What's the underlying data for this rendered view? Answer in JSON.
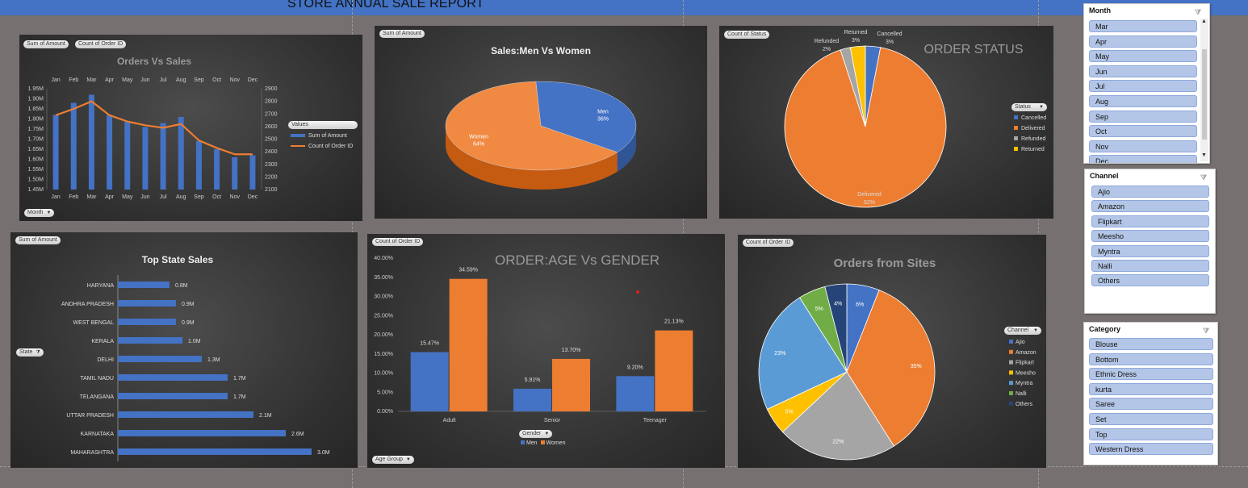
{
  "report_title": "STORE ANNUAL SALE REPORT",
  "orders_vs_sales": {
    "chips": [
      "Sum of Amount",
      "Count of Order ID"
    ],
    "axis_chip": "Month",
    "legend_chip": "Values",
    "legend": [
      "Sum of Amount",
      "Count of Order ID"
    ],
    "colors": {
      "bar": "#4472c4",
      "line": "#ed7d31"
    }
  },
  "sales_gender": {
    "chip": "Sum of Amount"
  },
  "order_status": {
    "chip": "Count of Status",
    "legend_chip": "Status"
  },
  "top_state": {
    "chip": "Sum of Amount",
    "axis_chip": "State"
  },
  "age_gender": {
    "chip": "Count of Order ID",
    "axis_chip": "Age Group",
    "legend_chip": "Gender",
    "legend": [
      "Men",
      "Women"
    ]
  },
  "sites": {
    "chip": "Count of Order ID",
    "legend_chip": "Channel"
  },
  "chart_data": [
    {
      "type": "bar",
      "title": "Orders Vs Sales",
      "categories": [
        "Jan",
        "Feb",
        "Mar",
        "Apr",
        "May",
        "Jun",
        "Jul",
        "Aug",
        "Sep",
        "Oct",
        "Nov",
        "Dec"
      ],
      "series": [
        {
          "name": "Sum of Amount",
          "type": "bar",
          "axis": "left",
          "values": [
            1.82,
            1.88,
            1.92,
            1.82,
            1.79,
            1.76,
            1.78,
            1.81,
            1.69,
            1.65,
            1.61,
            1.62
          ]
        },
        {
          "name": "Count of Order ID",
          "type": "line",
          "axis": "right",
          "values": [
            2690,
            2740,
            2800,
            2690,
            2640,
            2610,
            2590,
            2620,
            2490,
            2430,
            2380,
            2380
          ]
        }
      ],
      "yticks_left": [
        "1.45M",
        "1.50M",
        "1.55M",
        "1.60M",
        "1.65M",
        "1.70M",
        "1.75M",
        "1.80M",
        "1.85M",
        "1.90M",
        "1.95M"
      ],
      "yticks_right": [
        "2100",
        "2200",
        "2300",
        "2400",
        "2500",
        "2600",
        "2700",
        "2800",
        "2900"
      ],
      "ylim_left": [
        1.45,
        1.95
      ],
      "ylim_right": [
        2100,
        2900
      ]
    },
    {
      "type": "pie",
      "title": "Sales:Men Vs Women",
      "labels": [
        "Men",
        "Women"
      ],
      "values": [
        36,
        64
      ],
      "value_labels": [
        "36%",
        "64%"
      ],
      "colors": [
        "#4472c4",
        "#ed7d31"
      ]
    },
    {
      "type": "pie",
      "title": "ORDER STATUS",
      "labels": [
        "Cancelled",
        "Delivered",
        "Refunded",
        "Returned"
      ],
      "values": [
        3,
        92,
        2,
        3
      ],
      "value_labels": [
        "3%",
        "92%",
        "2%",
        "3%"
      ],
      "colors": [
        "#4472c4",
        "#ed7d31",
        "#a5a5a5",
        "#ffc000"
      ]
    },
    {
      "type": "bar",
      "orientation": "horizontal",
      "title": "Top State Sales",
      "categories": [
        "HARYANA",
        "ANDHRA PRADESH",
        "WEST BENGAL",
        "KERALA",
        "DELHI",
        "TAMIL NADU",
        "TELANGANA",
        "UTTAR PRADESH",
        "KARNATAKA",
        "MAHARASHTRA"
      ],
      "values": [
        0.8,
        0.9,
        0.9,
        1.0,
        1.3,
        1.7,
        1.7,
        2.1,
        2.6,
        3.0
      ],
      "value_labels": [
        "0.8M",
        "0.9M",
        "0.9M",
        "1.0M",
        "1.3M",
        "1.7M",
        "1.7M",
        "2.1M",
        "2.6M",
        "3.0M"
      ],
      "xlim": [
        0,
        3.15
      ]
    },
    {
      "type": "bar",
      "title": "ORDER:AGE Vs GENDER",
      "categories": [
        "Adult",
        "Senior",
        "Teenager"
      ],
      "series": [
        {
          "name": "Men",
          "values": [
            15.47,
            5.91,
            9.2
          ],
          "value_labels": [
            "15.47%",
            "5.91%",
            "9.20%"
          ]
        },
        {
          "name": "Women",
          "values": [
            34.59,
            13.7,
            21.13
          ],
          "value_labels": [
            "34.59%",
            "13.70%",
            "21.13%"
          ]
        }
      ],
      "yticks": [
        "0.00%",
        "5.00%",
        "10.00%",
        "15.00%",
        "20.00%",
        "25.00%",
        "30.00%",
        "35.00%",
        "40.00%"
      ],
      "ylim": [
        0,
        40
      ]
    },
    {
      "type": "pie",
      "title": "Orders from Sites",
      "labels": [
        "Ajio",
        "Amazon",
        "Flipkart",
        "Meesho",
        "Myntra",
        "Nalli",
        "Others"
      ],
      "values": [
        6,
        35,
        22,
        5,
        23,
        5,
        4
      ],
      "value_labels": [
        "6%",
        "35%",
        "22%",
        "5%",
        "23%",
        "5%",
        "4%"
      ],
      "colors": [
        "#4472c4",
        "#ed7d31",
        "#a5a5a5",
        "#ffc000",
        "#5b9bd5",
        "#70ad47",
        "#264478"
      ]
    }
  ],
  "slicers": {
    "month": {
      "title": "Month",
      "items": [
        "Mar",
        "Apr",
        "May",
        "Jun",
        "Jul",
        "Aug",
        "Sep",
        "Oct",
        "Nov",
        "Dec"
      ]
    },
    "channel": {
      "title": "Channel",
      "items": [
        "Ajio",
        "Amazon",
        "Flipkart",
        "Meesho",
        "Myntra",
        "Nalli",
        "Others"
      ]
    },
    "category": {
      "title": "Category",
      "items": [
        "Blouse",
        "Bottom",
        "Ethnic Dress",
        "kurta",
        "Saree",
        "Set",
        "Top",
        "Western Dress"
      ]
    }
  }
}
